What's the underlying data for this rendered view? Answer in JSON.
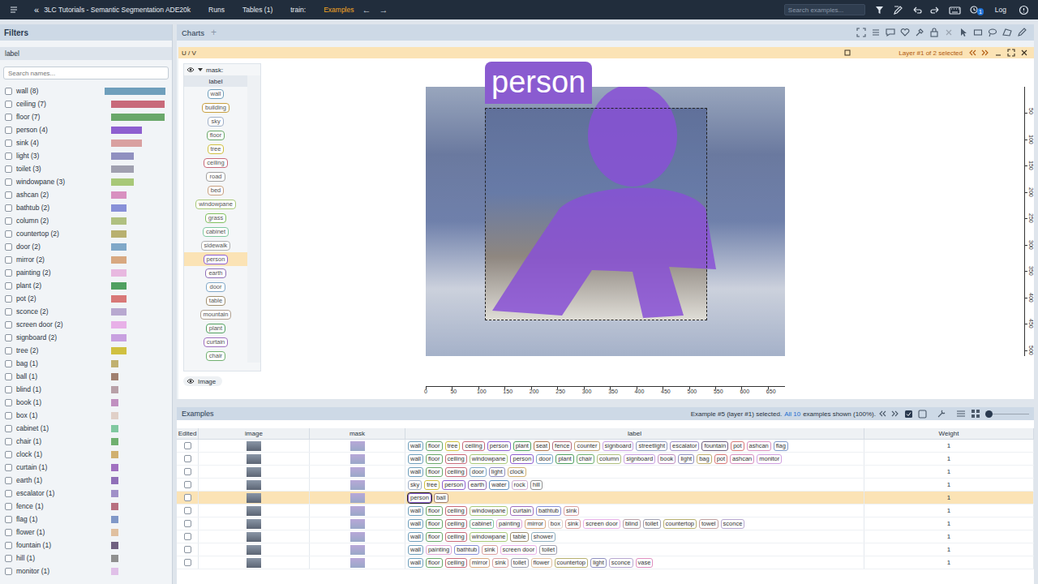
{
  "app": {
    "back": "«",
    "title": "3LC Tutorials - Semantic Segmentation ADE20k"
  },
  "nav": [
    {
      "label": "Runs",
      "selected": false
    },
    {
      "label": "Tables (1)",
      "selected": false
    },
    {
      "label": "train:",
      "selected": false
    },
    {
      "label": "Examples",
      "selected": true
    }
  ],
  "nav_arrows": [
    "←",
    "→"
  ],
  "search": {
    "placeholder": "Search examples..."
  },
  "notification_badge": "1",
  "log": "Log",
  "filters": {
    "title": "Filters",
    "section": "label",
    "search_placeholder": "Search names...",
    "items": [
      {
        "name": "wall (8)",
        "checked": false,
        "level": 1,
        "color": "#6f9fbc"
      },
      {
        "name": "ceiling (7)",
        "checked": false,
        "level": 0.875,
        "color": "#c86a7a"
      },
      {
        "name": "floor (7)",
        "checked": false,
        "level": 0.875,
        "color": "#6aa86a"
      },
      {
        "name": "person (4)",
        "checked": false,
        "level": 0.5,
        "color": "#8e5fd0"
      },
      {
        "name": "sink (4)",
        "checked": false,
        "level": 0.5,
        "color": "#d9a0a0"
      },
      {
        "name": "light (3)",
        "checked": false,
        "level": 0.375,
        "color": "#9090c0"
      },
      {
        "name": "toilet (3)",
        "checked": false,
        "level": 0.375,
        "color": "#a0a0b0"
      },
      {
        "name": "windowpane (3)",
        "checked": false,
        "level": 0.375,
        "color": "#a8c878"
      },
      {
        "name": "ashcan (2)",
        "checked": false,
        "level": 0.25,
        "color": "#d890c0"
      },
      {
        "name": "bathtub (2)",
        "checked": false,
        "level": 0.25,
        "color": "#8890d8"
      },
      {
        "name": "column (2)",
        "checked": false,
        "level": 0.25,
        "color": "#b0c080"
      },
      {
        "name": "countertop (2)",
        "checked": false,
        "level": 0.25,
        "color": "#b8b070"
      },
      {
        "name": "door (2)",
        "checked": false,
        "level": 0.25,
        "color": "#80a8c8"
      },
      {
        "name": "mirror (2)",
        "checked": false,
        "level": 0.25,
        "color": "#d8a880"
      },
      {
        "name": "painting (2)",
        "checked": false,
        "level": 0.25,
        "color": "#e8b8e0"
      },
      {
        "name": "plant (2)",
        "checked": false,
        "level": 0.25,
        "color": "#50a060"
      },
      {
        "name": "pot (2)",
        "checked": false,
        "level": 0.25,
        "color": "#d87878"
      },
      {
        "name": "sconce (2)",
        "checked": false,
        "level": 0.25,
        "color": "#b8a8d0"
      },
      {
        "name": "screen door (2)",
        "checked": false,
        "level": 0.25,
        "color": "#e8b0e8"
      },
      {
        "name": "signboard (2)",
        "checked": false,
        "level": 0.25,
        "color": "#c8a0e0"
      },
      {
        "name": "tree (2)",
        "checked": false,
        "level": 0.25,
        "color": "#d0c040"
      },
      {
        "name": "bag (1)",
        "checked": false,
        "level": 0.125,
        "color": "#c0b070"
      },
      {
        "name": "ball (1)",
        "checked": false,
        "level": 0.125,
        "color": "#a08070"
      },
      {
        "name": "blind (1)",
        "checked": false,
        "level": 0.125,
        "color": "#b8a0a8"
      },
      {
        "name": "book (1)",
        "checked": false,
        "level": 0.125,
        "color": "#c090c0"
      },
      {
        "name": "box (1)",
        "checked": false,
        "level": 0.125,
        "color": "#e0d0c8"
      },
      {
        "name": "cabinet (1)",
        "checked": false,
        "level": 0.125,
        "color": "#80c8a0"
      },
      {
        "name": "chair (1)",
        "checked": false,
        "level": 0.125,
        "color": "#70b070"
      },
      {
        "name": "clock (1)",
        "checked": false,
        "level": 0.125,
        "color": "#d0b070"
      },
      {
        "name": "curtain (1)",
        "checked": false,
        "level": 0.125,
        "color": "#a070c0"
      },
      {
        "name": "earth (1)",
        "checked": false,
        "level": 0.125,
        "color": "#9070b8"
      },
      {
        "name": "escalator (1)",
        "checked": false,
        "level": 0.125,
        "color": "#a090c8"
      },
      {
        "name": "fence (1)",
        "checked": false,
        "level": 0.125,
        "color": "#b87080"
      },
      {
        "name": "flag (1)",
        "checked": false,
        "level": 0.125,
        "color": "#8098c8"
      },
      {
        "name": "flower (1)",
        "checked": false,
        "level": 0.125,
        "color": "#e0c0a0"
      },
      {
        "name": "fountain (1)",
        "checked": false,
        "level": 0.125,
        "color": "#706080"
      },
      {
        "name": "hill (1)",
        "checked": false,
        "level": 0.125,
        "color": "#909090"
      },
      {
        "name": "monitor (1)",
        "checked": false,
        "level": 0.125,
        "color": "#e0c0e8"
      }
    ]
  },
  "charts": {
    "title": "Charts",
    "add": "+",
    "chart": {
      "title": "U / V",
      "layer_status": "Layer #1 of 2 selected",
      "layer_panel": {
        "title": "mask:",
        "column": "label",
        "image_layer": "Image",
        "items": [
          {
            "label": "wall",
            "selected": false,
            "color": "#6f9fbc"
          },
          {
            "label": "building",
            "selected": false,
            "color": "#c8a040"
          },
          {
            "label": "sky",
            "selected": false,
            "color": "#a0b0c8"
          },
          {
            "label": "floor",
            "selected": false,
            "color": "#6aa86a"
          },
          {
            "label": "tree",
            "selected": false,
            "color": "#d0c040"
          },
          {
            "label": "ceiling",
            "selected": false,
            "color": "#c86a7a"
          },
          {
            "label": "road",
            "selected": false,
            "color": "#a0a0a0"
          },
          {
            "label": "bed",
            "selected": false,
            "color": "#c8a080"
          },
          {
            "label": "windowpane",
            "selected": false,
            "color": "#a8c878"
          },
          {
            "label": "grass",
            "selected": false,
            "color": "#80c060"
          },
          {
            "label": "cabinet",
            "selected": false,
            "color": "#80c8a0"
          },
          {
            "label": "sidewalk",
            "selected": false,
            "color": "#b0b0b0"
          },
          {
            "label": "person",
            "selected": true,
            "color": "#8e5fd0"
          },
          {
            "label": "earth",
            "selected": false,
            "color": "#9070b8"
          },
          {
            "label": "door",
            "selected": false,
            "color": "#80a8c8"
          },
          {
            "label": "table",
            "selected": false,
            "color": "#a09070"
          },
          {
            "label": "mountain",
            "selected": false,
            "color": "#b0a090"
          },
          {
            "label": "plant",
            "selected": false,
            "color": "#50a060"
          },
          {
            "label": "curtain",
            "selected": false,
            "color": "#a070c0"
          },
          {
            "label": "chair",
            "selected": false,
            "color": "#70b070"
          }
        ]
      },
      "overlay_label": "person",
      "x_ticks": [
        "0",
        "50",
        "100",
        "150",
        "200",
        "250",
        "300",
        "350",
        "400",
        "450",
        "500",
        "550",
        "600",
        "650"
      ],
      "y_ticks": [
        "50",
        "100",
        "150",
        "200",
        "250",
        "300",
        "350",
        "400",
        "450",
        "500"
      ]
    }
  },
  "examples": {
    "title": "Examples",
    "status": "Example #5 (layer #1) selected.",
    "shown_count": "All 10",
    "shown_rest": "examples shown (100%).",
    "thumb_size": {
      "level": 0
    },
    "columns": [
      "Edited",
      "image",
      "mask",
      "label",
      "Weight"
    ],
    "label_colors": {
      "wall": "#6f9fbc",
      "floor": "#6aa86a",
      "tree": "#d0c040",
      "ceiling": "#c86a7a",
      "person": "#8e5fd0",
      "plant": "#50a060",
      "seat": "#b07850",
      "fence": "#b87080",
      "counter": "#c0a070",
      "signboard": "#c8a0e0",
      "streetlight": "#909cc0",
      "escalator": "#a090c8",
      "fountain": "#706080",
      "pot": "#d87878",
      "ashcan": "#d890c0",
      "flag": "#8098c8",
      "windowpane": "#a8c878",
      "door": "#80a8c8",
      "chair": "#70b070",
      "column": "#b0c080",
      "book": "#c090c0",
      "light": "#9090c0",
      "bag": "#c0b070",
      "monitor": "#d0a0e0",
      "clock": "#d0b070",
      "sky": "#a0b0c8",
      "earth": "#9070b8",
      "water": "#6090c0",
      "rock": "#d0b0d0",
      "hill": "#909090",
      "ball": "#a08070",
      "curtain": "#a070c0",
      "bathtub": "#8890d8",
      "sink": "#d9a0a0",
      "cabinet": "#80c8a0",
      "painting": "#e0a8d8",
      "mirror": "#d8a880",
      "box": "#e0d0c8",
      "screen door": "#e8b0e8",
      "blind": "#b8a0a8",
      "toilet": "#a0a0b0",
      "countertop": "#b8b070",
      "towel": "#c0a0a0",
      "sconce": "#b8a8d0",
      "table": "#a09070",
      "shower": "#90b0c0",
      "flower": "#e0c0a0",
      "vase": "#e090c0"
    },
    "rows": [
      {
        "edited": false,
        "selected": false,
        "weight": "1",
        "labels": [
          "wall",
          "floor",
          "tree",
          "ceiling",
          "person",
          "plant",
          "seat",
          "fence",
          "counter",
          "signboard",
          "streetlight",
          "escalator",
          "fountain",
          "pot",
          "ashcan",
          "flag"
        ]
      },
      {
        "edited": false,
        "selected": false,
        "weight": "1",
        "labels": [
          "wall",
          "floor",
          "ceiling",
          "windowpane",
          "person",
          "door",
          "plant",
          "chair",
          "column",
          "signboard",
          "book",
          "light",
          "bag",
          "pot",
          "ashcan",
          "monitor"
        ]
      },
      {
        "edited": false,
        "selected": false,
        "weight": "1",
        "labels": [
          "wall",
          "floor",
          "ceiling",
          "door",
          "light",
          "clock"
        ]
      },
      {
        "edited": false,
        "selected": false,
        "weight": "1",
        "labels": [
          "sky",
          "tree",
          "person",
          "earth",
          "water",
          "rock",
          "hill"
        ]
      },
      {
        "edited": false,
        "selected": true,
        "weight": "1",
        "labels": [
          "person",
          "ball"
        ]
      },
      {
        "edited": false,
        "selected": false,
        "weight": "1",
        "labels": [
          "wall",
          "floor",
          "ceiling",
          "windowpane",
          "curtain",
          "bathtub",
          "sink"
        ]
      },
      {
        "edited": false,
        "selected": false,
        "weight": "1",
        "labels": [
          "wall",
          "floor",
          "ceiling",
          "cabinet",
          "painting",
          "mirror",
          "box",
          "sink",
          "screen door",
          "blind",
          "toilet",
          "countertop",
          "towel",
          "sconce"
        ]
      },
      {
        "edited": false,
        "selected": false,
        "weight": "1",
        "labels": [
          "wall",
          "floor",
          "ceiling",
          "windowpane",
          "table",
          "shower"
        ]
      },
      {
        "edited": false,
        "selected": false,
        "weight": "1",
        "labels": [
          "wall",
          "painting",
          "bathtub",
          "sink",
          "screen door",
          "toilet"
        ]
      },
      {
        "edited": false,
        "selected": false,
        "weight": "1",
        "labels": [
          "wall",
          "floor",
          "ceiling",
          "mirror",
          "sink",
          "toilet",
          "flower",
          "countertop",
          "light",
          "sconce",
          "vase"
        ]
      }
    ]
  }
}
